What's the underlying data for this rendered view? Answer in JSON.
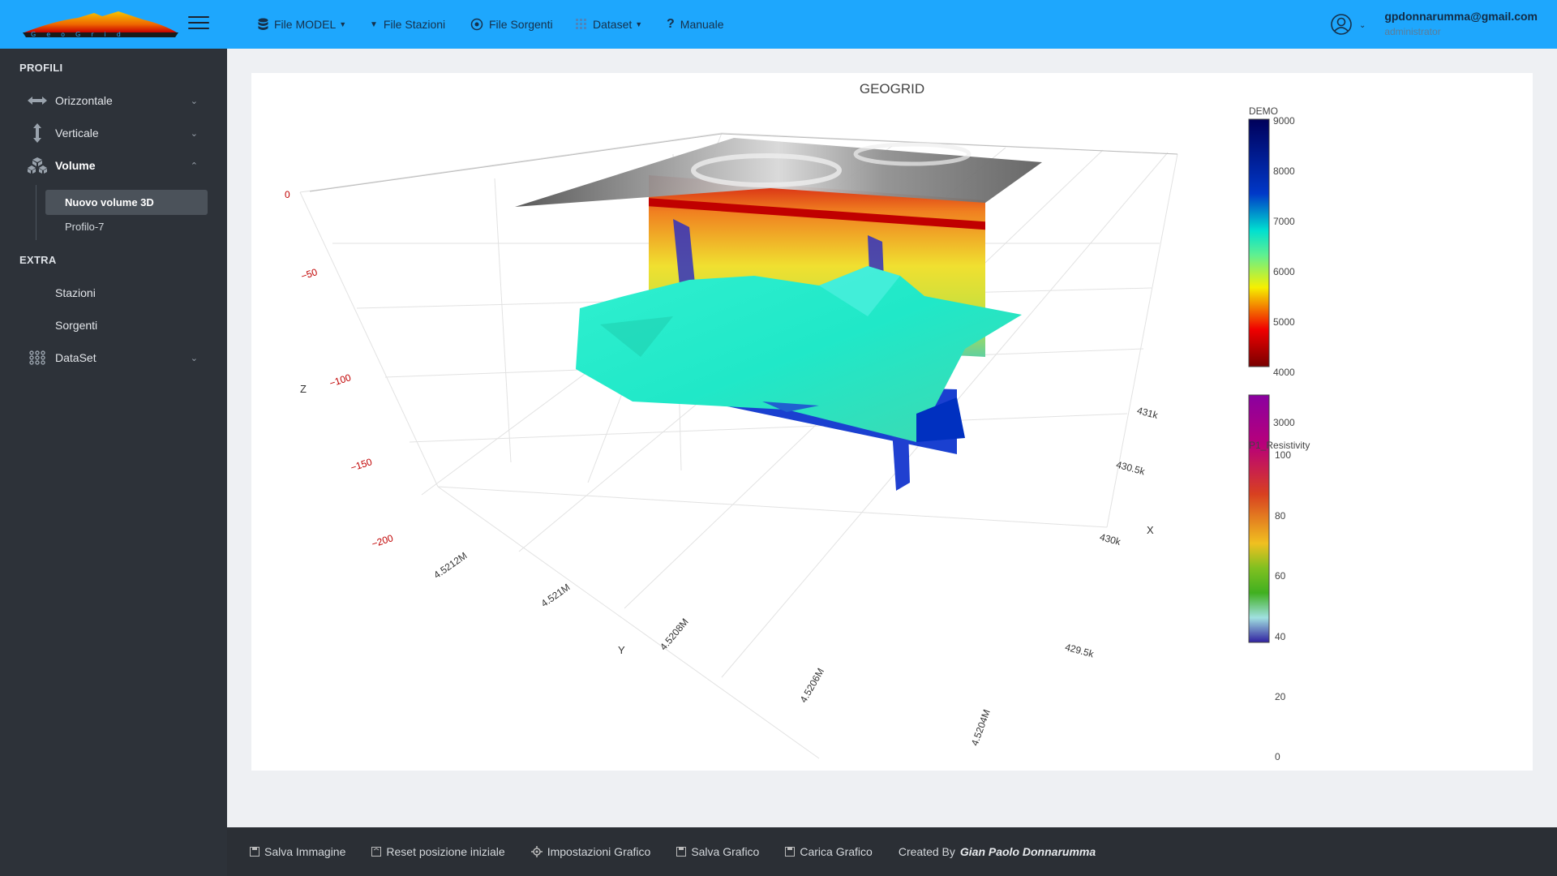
{
  "sidebar": {
    "sections": {
      "profili": "PROFILI",
      "extra": "EXTRA"
    },
    "items": {
      "orizzontale": "Orizzontale",
      "verticale": "Verticale",
      "volume": "Volume",
      "stazioni": "Stazioni",
      "sorgenti": "Sorgenti",
      "dataset": "DataSet"
    },
    "volume_children": {
      "active": "Nuovo volume 3D",
      "other": "Profilo-7"
    }
  },
  "topnav": {
    "file_model": "File MODEL",
    "file_stazioni": "File Stazioni",
    "file_sorgenti": "File Sorgenti",
    "dataset": "Dataset",
    "manuale": "Manuale"
  },
  "user": {
    "email": "gpdonnarumma@gmail.com",
    "role": "administrator"
  },
  "chart_data": {
    "type": "3d-volume",
    "title": "GEOGRID",
    "axes": {
      "z": {
        "label": "Z",
        "ticks": [
          "0",
          "−50",
          "−100",
          "−150",
          "−200"
        ]
      },
      "y": {
        "label": "Y",
        "ticks": [
          "4.5212M",
          "4.521M",
          "4.5208M",
          "4.5206M",
          "4.5204M"
        ]
      },
      "x": {
        "label": "X",
        "ticks": [
          "431k",
          "430.5k",
          "430k",
          "429.5k"
        ]
      }
    },
    "colorbars": [
      {
        "name": "DEMO",
        "ticks": [
          "9000",
          "8000",
          "7000",
          "6000",
          "5000",
          "4000",
          "3000"
        ],
        "range": [
          3000,
          9000
        ]
      },
      {
        "name": "P1_Resistivity",
        "ticks": [
          "100",
          "80",
          "60",
          "40",
          "20",
          "0"
        ],
        "range": [
          0,
          100
        ]
      }
    ]
  },
  "footer": {
    "salva_immagine": "Salva Immagine",
    "reset": "Reset posizione iniziale",
    "impostazioni": "Impostazioni Grafico",
    "salva_grafico": "Salva Grafico",
    "carica_grafico": "Carica Grafico",
    "created_by": "Created By",
    "author": "Gian Paolo Donnarumma"
  },
  "colors": {
    "topbar": "#1ea7fd",
    "sidebar": "#2d3239",
    "footer": "#2b2f35"
  }
}
